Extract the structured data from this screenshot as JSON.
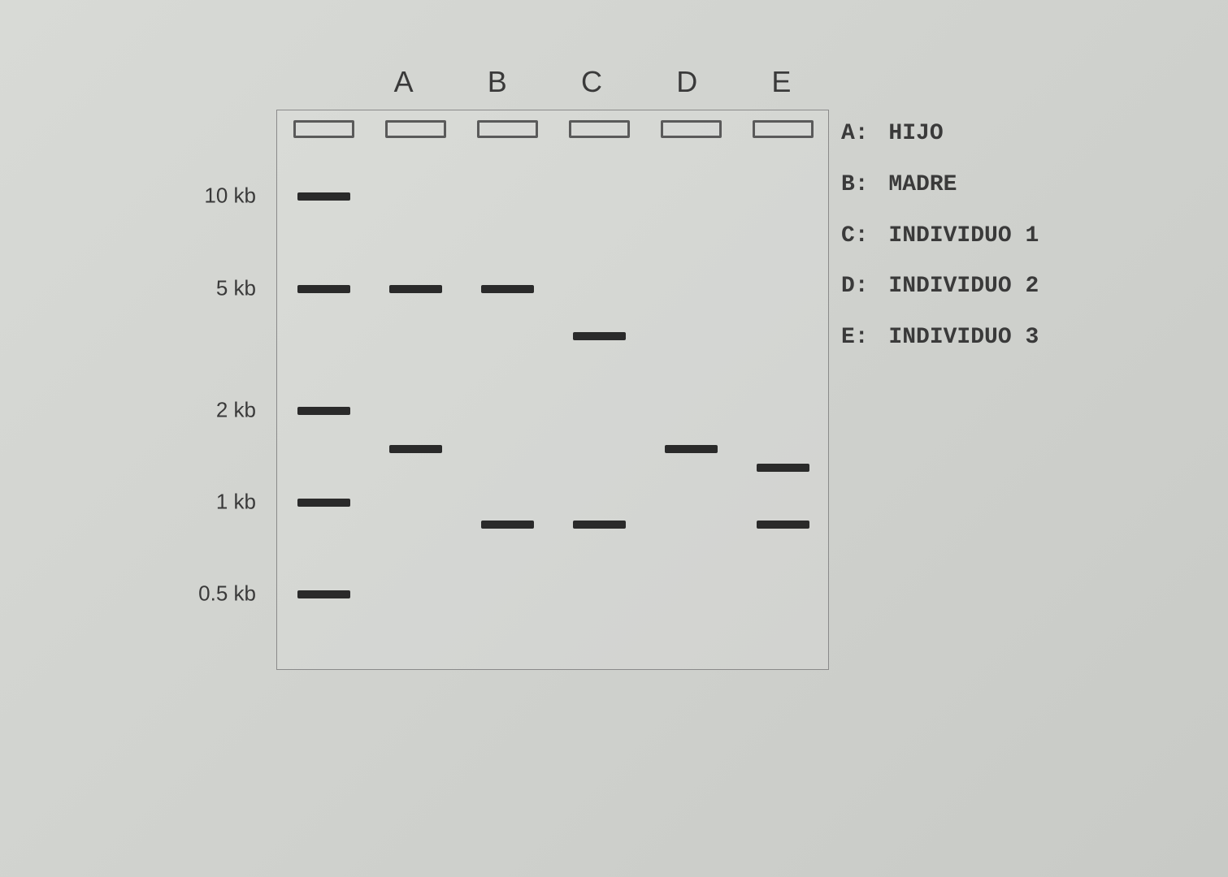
{
  "chart_data": {
    "type": "table",
    "title": "",
    "lane_headers": [
      "A",
      "B",
      "C",
      "D",
      "E"
    ],
    "ladder_sizes_kb": [
      10,
      5,
      2,
      1,
      0.5
    ],
    "ladder_labels": [
      "10 kb",
      "5 kb",
      "2 kb",
      "1 kb",
      "0.5 kb"
    ],
    "lanes": {
      "Ladder": [
        10,
        5,
        2,
        1,
        0.5
      ],
      "A": [
        5,
        1.5
      ],
      "B": [
        5,
        0.85
      ],
      "C": [
        3.5,
        0.85
      ],
      "D": [
        1.5
      ],
      "E": [
        1.3,
        0.85
      ]
    },
    "legend": [
      {
        "key": "A:",
        "label": "HIJO"
      },
      {
        "key": "B:",
        "label": "MADRE"
      },
      {
        "key": "C:",
        "label": "INDIVIDUO 1"
      },
      {
        "key": "D:",
        "label": "INDIVIDUO 2"
      },
      {
        "key": "E:",
        "label": "INDIVIDUO 3"
      }
    ],
    "y_axis_type": "log",
    "yrange_kb": [
      0.3,
      15
    ]
  }
}
